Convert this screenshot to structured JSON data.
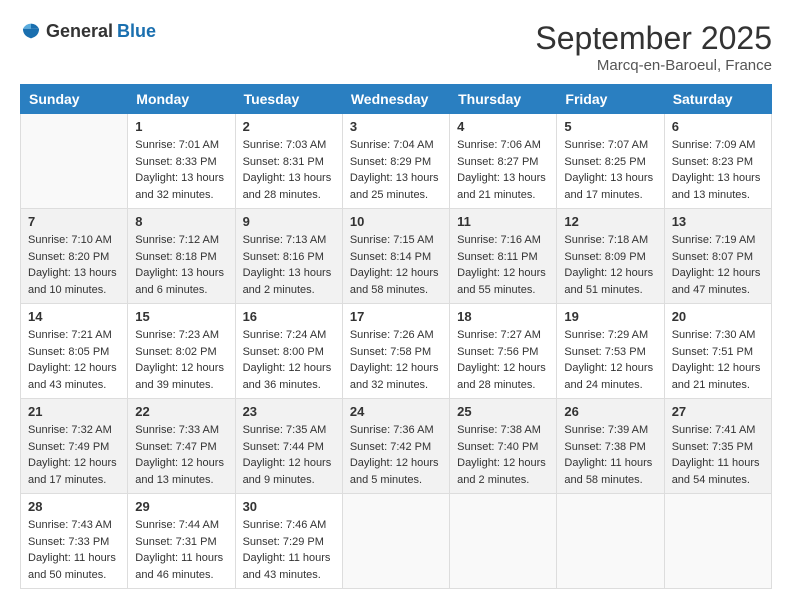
{
  "header": {
    "logo": {
      "general": "General",
      "blue": "Blue"
    },
    "month_year": "September 2025",
    "location": "Marcq-en-Baroeul, France"
  },
  "days_of_week": [
    "Sunday",
    "Monday",
    "Tuesday",
    "Wednesday",
    "Thursday",
    "Friday",
    "Saturday"
  ],
  "weeks": [
    {
      "shaded": false,
      "days": [
        {
          "number": "",
          "sunrise": "",
          "sunset": "",
          "daylight": ""
        },
        {
          "number": "1",
          "sunrise": "Sunrise: 7:01 AM",
          "sunset": "Sunset: 8:33 PM",
          "daylight": "Daylight: 13 hours and 32 minutes."
        },
        {
          "number": "2",
          "sunrise": "Sunrise: 7:03 AM",
          "sunset": "Sunset: 8:31 PM",
          "daylight": "Daylight: 13 hours and 28 minutes."
        },
        {
          "number": "3",
          "sunrise": "Sunrise: 7:04 AM",
          "sunset": "Sunset: 8:29 PM",
          "daylight": "Daylight: 13 hours and 25 minutes."
        },
        {
          "number": "4",
          "sunrise": "Sunrise: 7:06 AM",
          "sunset": "Sunset: 8:27 PM",
          "daylight": "Daylight: 13 hours and 21 minutes."
        },
        {
          "number": "5",
          "sunrise": "Sunrise: 7:07 AM",
          "sunset": "Sunset: 8:25 PM",
          "daylight": "Daylight: 13 hours and 17 minutes."
        },
        {
          "number": "6",
          "sunrise": "Sunrise: 7:09 AM",
          "sunset": "Sunset: 8:23 PM",
          "daylight": "Daylight: 13 hours and 13 minutes."
        }
      ]
    },
    {
      "shaded": true,
      "days": [
        {
          "number": "7",
          "sunrise": "Sunrise: 7:10 AM",
          "sunset": "Sunset: 8:20 PM",
          "daylight": "Daylight: 13 hours and 10 minutes."
        },
        {
          "number": "8",
          "sunrise": "Sunrise: 7:12 AM",
          "sunset": "Sunset: 8:18 PM",
          "daylight": "Daylight: 13 hours and 6 minutes."
        },
        {
          "number": "9",
          "sunrise": "Sunrise: 7:13 AM",
          "sunset": "Sunset: 8:16 PM",
          "daylight": "Daylight: 13 hours and 2 minutes."
        },
        {
          "number": "10",
          "sunrise": "Sunrise: 7:15 AM",
          "sunset": "Sunset: 8:14 PM",
          "daylight": "Daylight: 12 hours and 58 minutes."
        },
        {
          "number": "11",
          "sunrise": "Sunrise: 7:16 AM",
          "sunset": "Sunset: 8:11 PM",
          "daylight": "Daylight: 12 hours and 55 minutes."
        },
        {
          "number": "12",
          "sunrise": "Sunrise: 7:18 AM",
          "sunset": "Sunset: 8:09 PM",
          "daylight": "Daylight: 12 hours and 51 minutes."
        },
        {
          "number": "13",
          "sunrise": "Sunrise: 7:19 AM",
          "sunset": "Sunset: 8:07 PM",
          "daylight": "Daylight: 12 hours and 47 minutes."
        }
      ]
    },
    {
      "shaded": false,
      "days": [
        {
          "number": "14",
          "sunrise": "Sunrise: 7:21 AM",
          "sunset": "Sunset: 8:05 PM",
          "daylight": "Daylight: 12 hours and 43 minutes."
        },
        {
          "number": "15",
          "sunrise": "Sunrise: 7:23 AM",
          "sunset": "Sunset: 8:02 PM",
          "daylight": "Daylight: 12 hours and 39 minutes."
        },
        {
          "number": "16",
          "sunrise": "Sunrise: 7:24 AM",
          "sunset": "Sunset: 8:00 PM",
          "daylight": "Daylight: 12 hours and 36 minutes."
        },
        {
          "number": "17",
          "sunrise": "Sunrise: 7:26 AM",
          "sunset": "Sunset: 7:58 PM",
          "daylight": "Daylight: 12 hours and 32 minutes."
        },
        {
          "number": "18",
          "sunrise": "Sunrise: 7:27 AM",
          "sunset": "Sunset: 7:56 PM",
          "daylight": "Daylight: 12 hours and 28 minutes."
        },
        {
          "number": "19",
          "sunrise": "Sunrise: 7:29 AM",
          "sunset": "Sunset: 7:53 PM",
          "daylight": "Daylight: 12 hours and 24 minutes."
        },
        {
          "number": "20",
          "sunrise": "Sunrise: 7:30 AM",
          "sunset": "Sunset: 7:51 PM",
          "daylight": "Daylight: 12 hours and 21 minutes."
        }
      ]
    },
    {
      "shaded": true,
      "days": [
        {
          "number": "21",
          "sunrise": "Sunrise: 7:32 AM",
          "sunset": "Sunset: 7:49 PM",
          "daylight": "Daylight: 12 hours and 17 minutes."
        },
        {
          "number": "22",
          "sunrise": "Sunrise: 7:33 AM",
          "sunset": "Sunset: 7:47 PM",
          "daylight": "Daylight: 12 hours and 13 minutes."
        },
        {
          "number": "23",
          "sunrise": "Sunrise: 7:35 AM",
          "sunset": "Sunset: 7:44 PM",
          "daylight": "Daylight: 12 hours and 9 minutes."
        },
        {
          "number": "24",
          "sunrise": "Sunrise: 7:36 AM",
          "sunset": "Sunset: 7:42 PM",
          "daylight": "Daylight: 12 hours and 5 minutes."
        },
        {
          "number": "25",
          "sunrise": "Sunrise: 7:38 AM",
          "sunset": "Sunset: 7:40 PM",
          "daylight": "Daylight: 12 hours and 2 minutes."
        },
        {
          "number": "26",
          "sunrise": "Sunrise: 7:39 AM",
          "sunset": "Sunset: 7:38 PM",
          "daylight": "Daylight: 11 hours and 58 minutes."
        },
        {
          "number": "27",
          "sunrise": "Sunrise: 7:41 AM",
          "sunset": "Sunset: 7:35 PM",
          "daylight": "Daylight: 11 hours and 54 minutes."
        }
      ]
    },
    {
      "shaded": false,
      "days": [
        {
          "number": "28",
          "sunrise": "Sunrise: 7:43 AM",
          "sunset": "Sunset: 7:33 PM",
          "daylight": "Daylight: 11 hours and 50 minutes."
        },
        {
          "number": "29",
          "sunrise": "Sunrise: 7:44 AM",
          "sunset": "Sunset: 7:31 PM",
          "daylight": "Daylight: 11 hours and 46 minutes."
        },
        {
          "number": "30",
          "sunrise": "Sunrise: 7:46 AM",
          "sunset": "Sunset: 7:29 PM",
          "daylight": "Daylight: 11 hours and 43 minutes."
        },
        {
          "number": "",
          "sunrise": "",
          "sunset": "",
          "daylight": ""
        },
        {
          "number": "",
          "sunrise": "",
          "sunset": "",
          "daylight": ""
        },
        {
          "number": "",
          "sunrise": "",
          "sunset": "",
          "daylight": ""
        },
        {
          "number": "",
          "sunrise": "",
          "sunset": "",
          "daylight": ""
        }
      ]
    }
  ]
}
